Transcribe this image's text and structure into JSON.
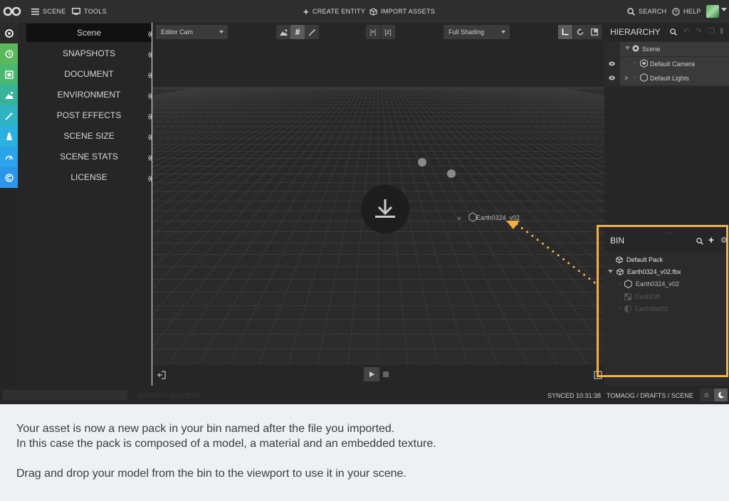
{
  "topbar": {
    "scene_label": "SCENE",
    "tools_label": "TOOLS",
    "create_entity_label": "CREATE ENTITY",
    "import_assets_label": "IMPORT ASSETS",
    "search_label": "SEARCH",
    "help_label": "HELP"
  },
  "scene_panel": {
    "items": [
      {
        "label": "Scene"
      },
      {
        "label": "SNAPSHOTS"
      },
      {
        "label": "DOCUMENT"
      },
      {
        "label": "ENVIRONMENT"
      },
      {
        "label": "POST EFFECTS"
      },
      {
        "label": "SCENE SIZE"
      },
      {
        "label": "SCENE STATS"
      },
      {
        "label": "LICENSE"
      }
    ],
    "strip_colors": [
      "#2b2b2b",
      "#5cb85c",
      "#4bb870",
      "#36b39a",
      "#30b4c4",
      "#2bb0e0",
      "#2aa4ea",
      "#2a96ec"
    ],
    "strip_icons": [
      "settings-icon",
      "history-icon",
      "document-icon",
      "environment-icon",
      "post-effects-icon",
      "scene-size-icon",
      "scene-stats-icon",
      "license-icon"
    ]
  },
  "viewport": {
    "camera_select": "Editor Cam",
    "shading_select": "Full Shading",
    "entity_label": "Earth0324_v02"
  },
  "hierarchy": {
    "title": "HIERARCHY",
    "items": [
      {
        "label": "Scene"
      },
      {
        "label": "Default Camera"
      },
      {
        "label": "Default Lights"
      }
    ]
  },
  "bin": {
    "title": "BIN",
    "items": [
      {
        "label": "Default Pack"
      },
      {
        "label": "Earth0324_v02.fbx"
      },
      {
        "label": "Earth0324_v02"
      },
      {
        "label": "EarthDiff"
      },
      {
        "label": "EarthMat02"
      }
    ]
  },
  "statusbar": {
    "activity": "ACTIVITY: SUCCESS",
    "synced": "SYNCED 10:31:38",
    "breadcrumb": "TOMAOG / DRAFTS / SCENE"
  },
  "caption": {
    "line1": "Your asset is now a new pack in your bin named after the file you imported.",
    "line2": "In this case the pack is composed of a model, a material and an embedded texture.",
    "line3": "Drag and drop your model from the bin to the viewport to use it in your scene."
  },
  "colors": {
    "accent_highlight": "#f5b13d",
    "panel_bg": "#2b2b2b",
    "topbar_bg": "#2e2e2e"
  }
}
